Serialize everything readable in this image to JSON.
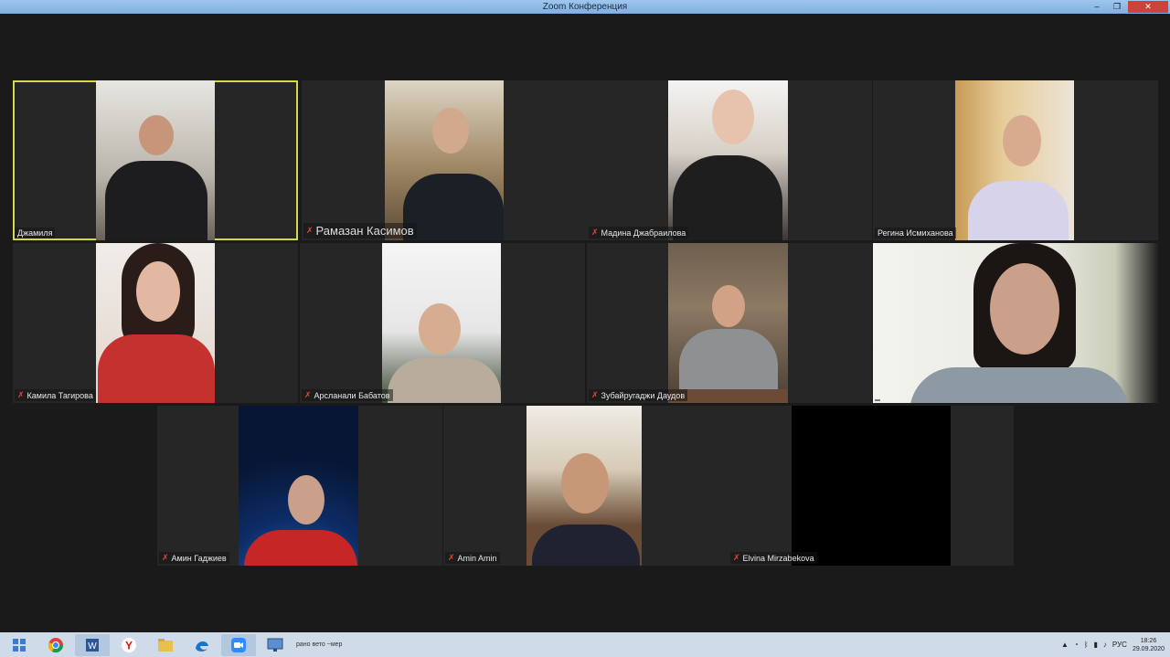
{
  "window": {
    "title": "Zoom Конференция",
    "controls": [
      "–",
      "❐",
      "✕"
    ]
  },
  "participants": [
    {
      "name": "Джамиля",
      "muted": false,
      "active": true
    },
    {
      "name": "Рамазан Касимов",
      "muted": true,
      "active": false
    },
    {
      "name": "Мадина Джабраилова",
      "muted": true,
      "active": false
    },
    {
      "name": "Регина Исмиханова",
      "muted": false,
      "active": false
    },
    {
      "name": "Камила Тагирова",
      "muted": true,
      "active": false
    },
    {
      "name": "Арсланали Бабатов",
      "muted": true,
      "active": false
    },
    {
      "name": "Зубайругаджи Даудов",
      "muted": true,
      "active": false
    },
    {
      "name": "",
      "muted": false,
      "active": false
    },
    {
      "name": "Амин Гаджиев",
      "muted": true,
      "active": false
    },
    {
      "name": "Amin Amin",
      "muted": true,
      "active": false
    },
    {
      "name": "Elvina Mirzabekova",
      "muted": true,
      "active": false
    }
  ],
  "taskbar": {
    "items": [
      "start-icon",
      "word-icon",
      "chrome-icon",
      "yandex-icon",
      "folder-icon",
      "edge-icon",
      "zoom-icon",
      "screen-icon"
    ],
    "partial_text": "рано   вето   ~мер",
    "tray": {
      "language": "РУС",
      "time": "18:26",
      "date": "29.09.2020"
    }
  },
  "colors": {
    "active_border": "#d4d84a",
    "muted_mic": "#e0463c",
    "titlebar": "#8fbbe8",
    "taskbar": "#cfdbe8"
  }
}
